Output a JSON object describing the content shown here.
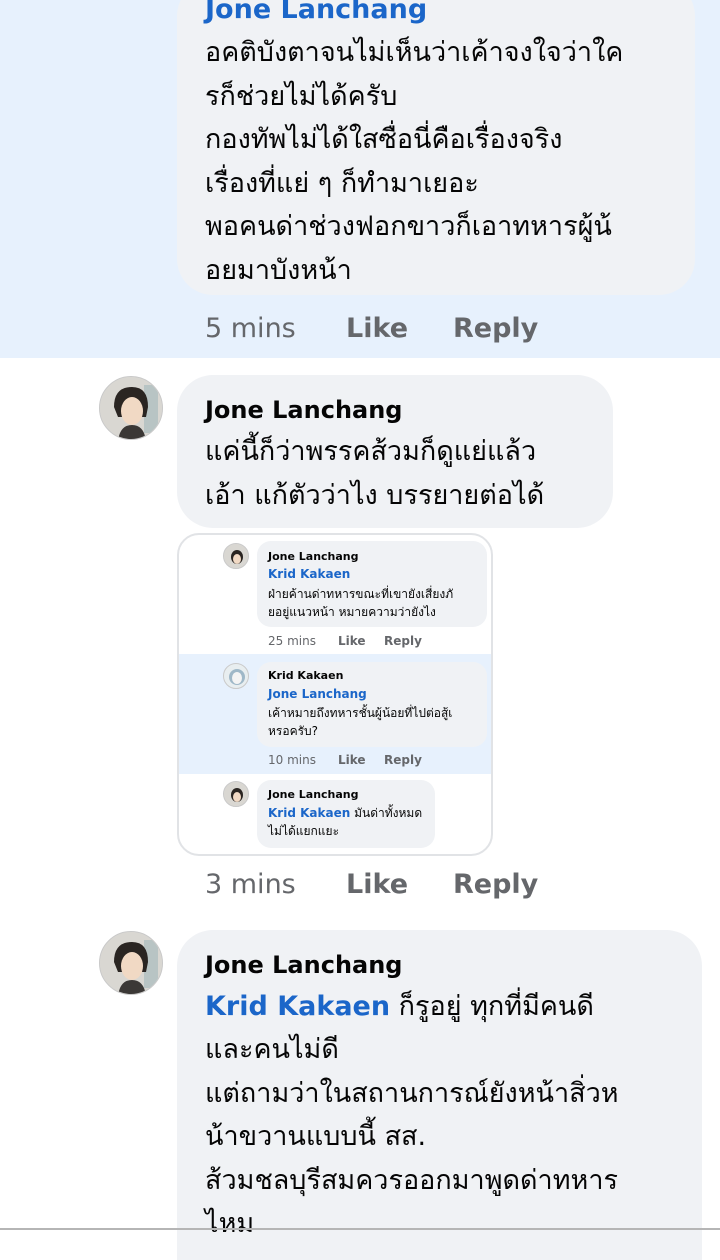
{
  "comments": [
    {
      "author": "Jone Lanchang",
      "text": "อคติบังตาจนไม่เห็นว่าเค้าจงใจว่าใค\nรก็ช่วยไม่ได้ครับ\nกองทัพไม่ได้ใสซื่อนี่คือเรื่องจริง\nเรื่องที่แย่ ๆ ก็ทำมาเยอะ\nพอคนด่าช่วงฟอกขาวก็เอาทหารผู้น้\nอยมาบังหน้า",
      "time": "5 mins",
      "like": "Like",
      "reply": "Reply"
    },
    {
      "author": "Jone Lanchang",
      "text": "แค่นี้ก็ว่าพรรคส้วมก็ดูแย่แล้ว\nเอ้า แก้ตัวว่าไง บรรยายต่อได้",
      "time": "3 mins",
      "like": "Like",
      "reply": "Reply",
      "screenshot": [
        {
          "author": "Jone Lanchang",
          "mention": "Krid Kakaen",
          "text": "ฝ่ายค้านด่าทหารขณะที่เขายังเสี่ยงภั\nยอยู่แนวหน้า หมายความว่ายังไง",
          "time": "25 mins",
          "like": "Like",
          "reply": "Reply"
        },
        {
          "author": "Krid Kakaen",
          "mention": "Jone Lanchang",
          "text": "เค้าหมายถึงทหารชั้นผู้น้อยที่ไปต่อสู้เ\nหรอครับ?",
          "time": "10 mins",
          "like": "Like",
          "reply": "Reply"
        },
        {
          "author": "Jone Lanchang",
          "mention": "Krid Kakaen",
          "text_inline": " มันด่าทั้งหมด",
          "text": "ไม่ได้แยกแยะ"
        }
      ]
    },
    {
      "author": "Jone Lanchang",
      "mention": "Krid Kakaen",
      "text_inline": " ก็รูอยู่ ทุกที่มีคนดี",
      "text": "และคนไม่ดี\nแต่ถามว่าในสถานการณ์ยังหน้าสิ่วห\nน้าขวานแบบนี้ สส.\nส้วมชลบุรีสมควรออกมาพูดด่าทหาร\nไหม"
    }
  ],
  "colors": {
    "highlight": "#e7f1fd",
    "bubble": "#f0f2f5",
    "mention": "#1b66c9",
    "meta": "#65676b"
  }
}
